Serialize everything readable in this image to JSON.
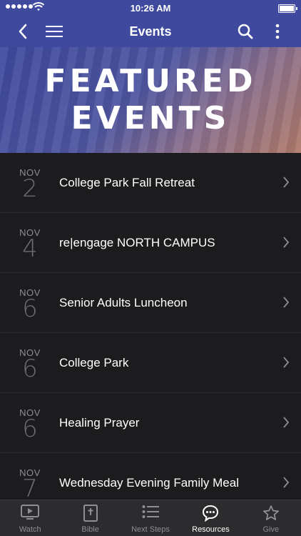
{
  "status": {
    "time": "10:26 AM"
  },
  "header": {
    "title": "Events"
  },
  "hero": {
    "line1": "FEATURED",
    "line2": "EVENTS"
  },
  "events": [
    {
      "month": "NOV",
      "day": "2",
      "title": "College Park Fall Retreat"
    },
    {
      "month": "NOV",
      "day": "4",
      "title": "re|engage NORTH CAMPUS"
    },
    {
      "month": "NOV",
      "day": "6",
      "title": "Senior Adults Luncheon"
    },
    {
      "month": "NOV",
      "day": "6",
      "title": "College Park"
    },
    {
      "month": "NOV",
      "day": "6",
      "title": "Healing Prayer"
    },
    {
      "month": "NOV",
      "day": "7",
      "title": "Wednesday Evening Family Meal"
    }
  ],
  "tabs": [
    {
      "label": "Watch",
      "icon": "play-screen-icon",
      "active": false
    },
    {
      "label": "Bible",
      "icon": "bible-icon",
      "active": false
    },
    {
      "label": "Next Steps",
      "icon": "list-icon",
      "active": false
    },
    {
      "label": "Resources",
      "icon": "chat-bubble-icon",
      "active": true
    },
    {
      "label": "Give",
      "icon": "star-icon",
      "active": false
    }
  ],
  "colors": {
    "header": "#3f4a9e",
    "background": "#1c1c1e",
    "tabbar": "#2c2c2e"
  }
}
